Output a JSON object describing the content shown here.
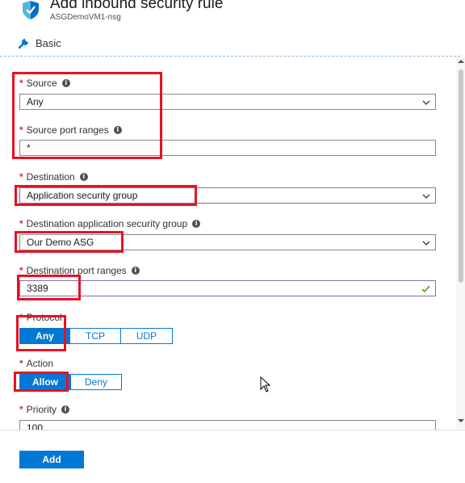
{
  "header": {
    "title": "Add inbound security rule",
    "subtitle": "ASGDemoVM1-nsg",
    "basic_label": "Basic"
  },
  "form": {
    "source": {
      "label": "Source",
      "value": "Any"
    },
    "source_port_ranges": {
      "label": "Source port ranges",
      "value": "*"
    },
    "destination": {
      "label": "Destination",
      "value": "Application security group"
    },
    "destination_asg": {
      "label": "Destination application security group",
      "value": "Our Demo ASG"
    },
    "destination_port_ranges": {
      "label": "Destination port ranges",
      "value": "3389"
    },
    "protocol": {
      "label": "Protocol",
      "options": [
        "Any",
        "TCP",
        "UDP"
      ],
      "selected": "Any"
    },
    "action": {
      "label": "Action",
      "options": [
        "Allow",
        "Deny"
      ],
      "selected": "Allow"
    },
    "priority": {
      "label": "Priority",
      "value": "100"
    }
  },
  "footer": {
    "add_label": "Add"
  },
  "colors": {
    "accent": "#0078d4",
    "highlight": "#e81123",
    "required": "#d13438",
    "valid": "#57a300"
  }
}
